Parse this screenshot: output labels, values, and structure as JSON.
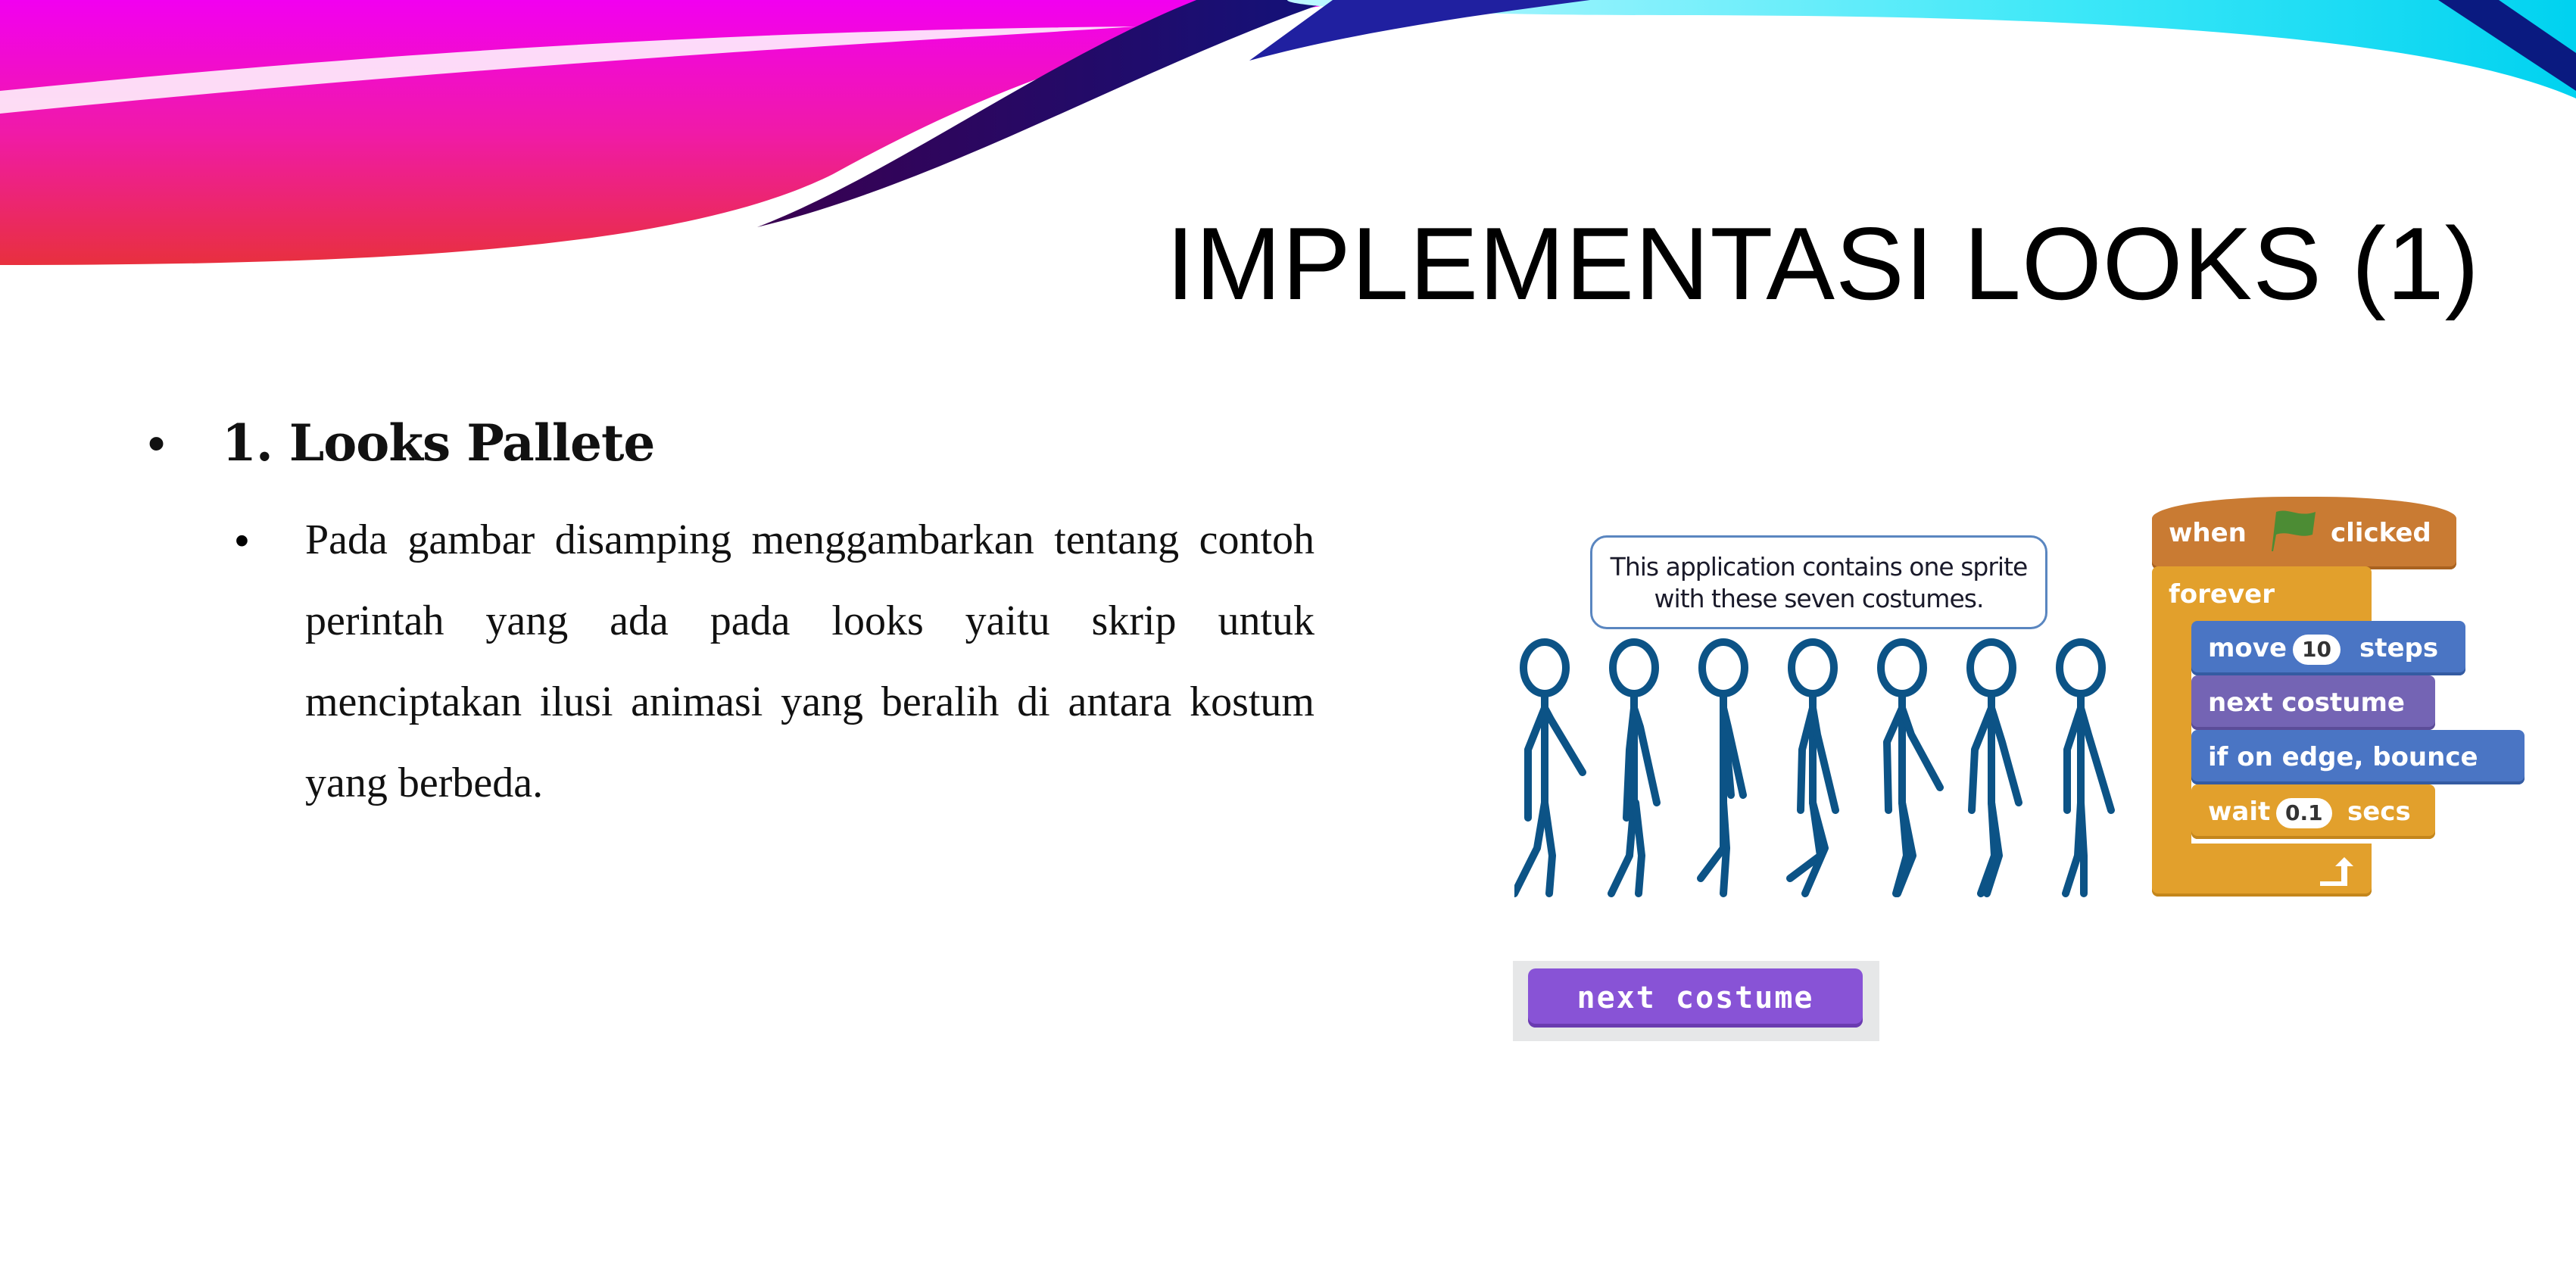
{
  "slide": {
    "title": "IMPLEMENTASI LOOKS (1)",
    "bullet_level1": {
      "marker": "•",
      "text": "1. Looks Pallete"
    },
    "bullet_level2": {
      "marker": "•",
      "text": "Pada gambar disamping menggambarkan tentang contoh perintah yang ada pada looks yaitu skrip untuk menciptakan ilusi animasi yang beralih di antara kostum yang berbeda."
    }
  },
  "illustration": {
    "speech_bubble": {
      "line1": "This application contains one sprite",
      "line2": "with these seven costumes."
    },
    "costume_count": 7,
    "figure_color": "#0c5386"
  },
  "script": {
    "hat": {
      "prefix": "when",
      "icon": "green-flag-icon",
      "suffix": "clicked"
    },
    "loop": {
      "label": "forever"
    },
    "blocks": [
      {
        "kind": "motion",
        "prefix": "move",
        "value": "10",
        "suffix": "steps"
      },
      {
        "kind": "looks",
        "label": "next costume"
      },
      {
        "kind": "motion",
        "label": "if on edge, bounce"
      },
      {
        "kind": "control",
        "prefix": "wait",
        "value": "0.1",
        "suffix": "secs"
      }
    ],
    "colors": {
      "events": "#c97b33",
      "control": "#e2a02c",
      "motion": "#4a75c4",
      "looks": "#7464b4",
      "flag": "#4c8c34"
    }
  },
  "standalone_block": {
    "label": "next costume",
    "color": "#8853d6"
  }
}
